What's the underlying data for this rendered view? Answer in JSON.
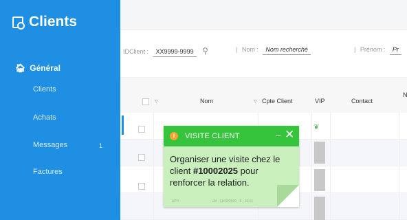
{
  "sidebar": {
    "title": "Clients",
    "section": "Général",
    "items": [
      {
        "label": "Clients"
      },
      {
        "label": "Achats"
      },
      {
        "label": "Messages"
      },
      {
        "label": "Factures"
      }
    ],
    "messages_count": "1"
  },
  "filters": {
    "idclient_label": "IDClient :",
    "idclient_value": "XX9999-9999",
    "nom_label": "Nom :",
    "nom_value": "Nom recherché",
    "prenom_label": "Prénom :",
    "prenom_value": "Pr"
  },
  "table": {
    "headers": [
      "Nom",
      "Cpte Client",
      "VIP",
      "Contact",
      "N"
    ]
  },
  "note": {
    "title": "VISITE CLIENT",
    "minimize": "–",
    "close": "✕",
    "body_prefix": "Organiser une visite chez le client ",
    "client_id": "#10002025",
    "body_suffix": " pour renforcer la relation.",
    "meta_left": "APP",
    "meta_right": "LM · 11/09/2020 · 8 · 10:01"
  }
}
